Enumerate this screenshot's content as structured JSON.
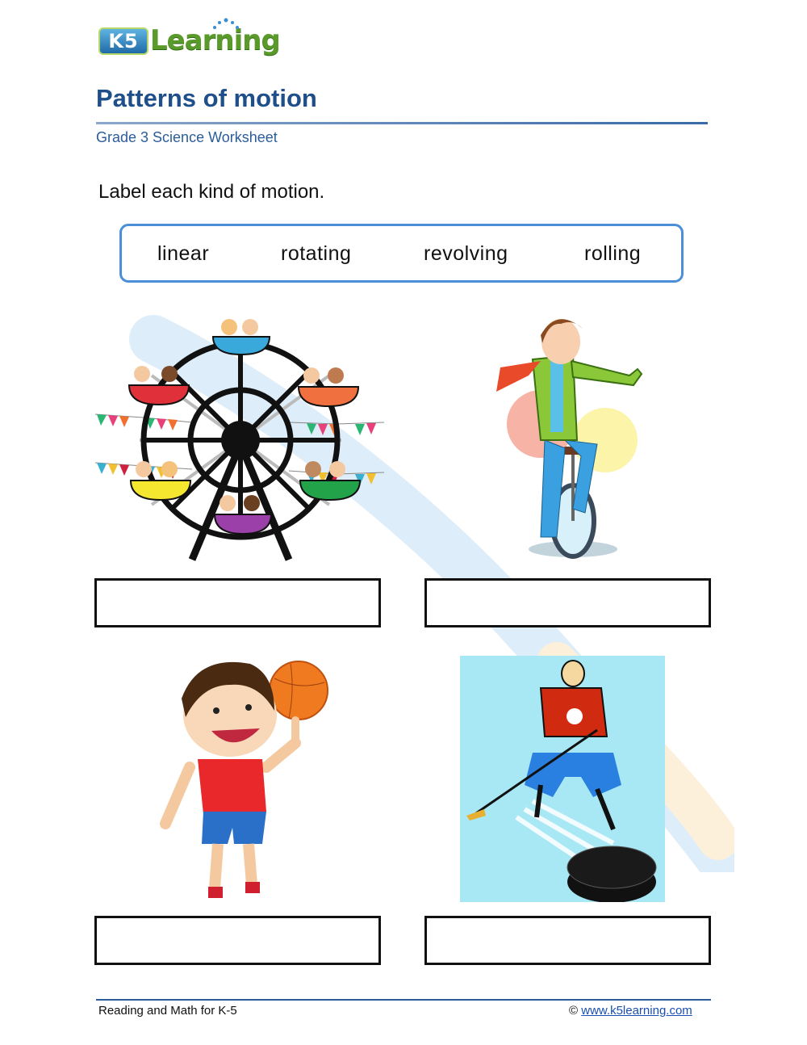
{
  "logo": {
    "badge": "K5",
    "wordmark": "Learning"
  },
  "header": {
    "title": "Patterns of motion",
    "subtitle": "Grade 3 Science Worksheet"
  },
  "instruction": "Label each kind of motion.",
  "word_bank": [
    "linear",
    "rotating",
    "revolving",
    "rolling"
  ],
  "pictures": [
    {
      "subject": "ferris wheel with children",
      "answer": ""
    },
    {
      "subject": "boy riding a unicycle",
      "answer": ""
    },
    {
      "subject": "boy spinning a basketball on finger",
      "answer": ""
    },
    {
      "subject": "hockey player hitting a puck",
      "answer": ""
    }
  ],
  "footer": {
    "left": "Reading and Math for K-5",
    "copyright": "©",
    "link": "www.k5learning.com"
  },
  "colors": {
    "title": "#1f4f8a",
    "subtitle": "#2b5d99",
    "word_bank_border": "#4b8fd8",
    "link": "#1a4fb0",
    "hockey_bg": "#a8e8f5"
  }
}
